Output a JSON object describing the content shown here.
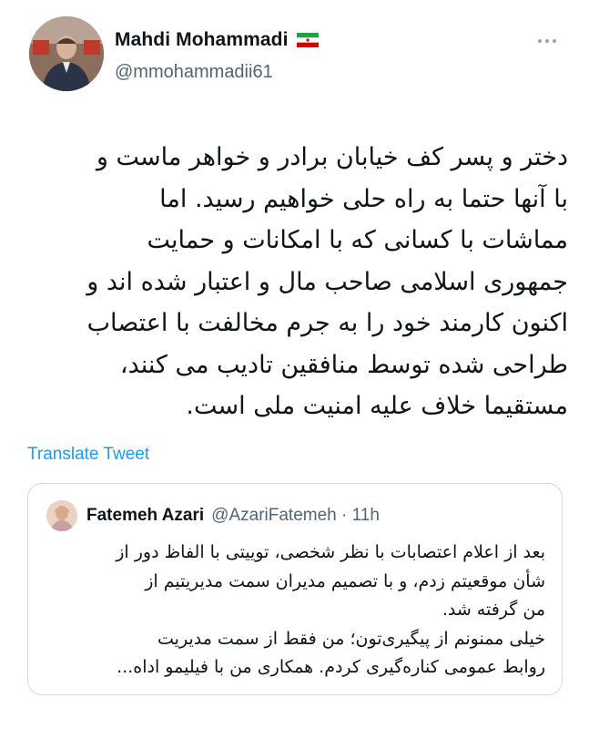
{
  "author": {
    "name": "Mahdi Mohammadi",
    "handle": "@mmohammadii61",
    "flag_icon": "iran-flag-icon"
  },
  "tweet": {
    "lines": [
      "دختر و پسر کف خیابان برادر و خواهر ماست و",
      "با آنها حتما به راه حلی خواهیم رسید. اما",
      "مماشات با کسانی که با امکانات و حمایت",
      "جمهوری اسلامی صاحب مال و اعتبار شده اند و",
      "اکنون کارمند خود را به جرم مخالفت با اعتصاب",
      "طراحی شده توسط منافقین تادیب می کنند،",
      "مستقیما خلاف علیه امنیت ملی است."
    ],
    "translate_label": "Translate Tweet"
  },
  "quote": {
    "name": "Fatemeh Azari",
    "meta": "@AzariFatemeh · 11h",
    "para1_lines": [
      "بعد از اعلام اعتصابات با نظر شخصی، توییتی با الفاظ دور از",
      "شأن موقعیتم زدم، و با تصمیم مدیران سمت مدیریتیم از",
      "من گرفته شد."
    ],
    "para2_lines": [
      "خیلی ممنونم از پیگیری‌تون؛ من فقط از سمت مدیریت",
      "روابط عمومی کناره‌گیری کردم. همکاری من با فیلیمو اداه..."
    ]
  },
  "colors": {
    "text": "#0f1419",
    "secondary": "#536471",
    "link": "#1d9bf0",
    "border": "#cfd9de"
  }
}
